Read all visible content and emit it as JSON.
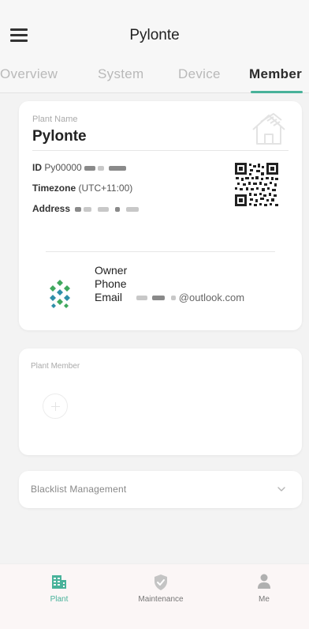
{
  "header": {
    "title": "Pylonte",
    "menu_icon": "hamburger-menu-icon"
  },
  "tabs": [
    {
      "label": "Overview",
      "active": false
    },
    {
      "label": "System",
      "active": false
    },
    {
      "label": "Device",
      "active": false
    },
    {
      "label": "Member",
      "active": true
    }
  ],
  "colors": {
    "accent": "#48b29a",
    "background": "#f3f3f3",
    "card": "#ffffff"
  },
  "plant": {
    "name_label": "Plant Name",
    "name": "Pylonte",
    "house_icon": "house-outline-icon",
    "qr_icon": "qr-code-icon",
    "id_label": "ID",
    "id_value": "Py00000",
    "timezone_label": "Timezone",
    "timezone_value": "(UTC+11:00)",
    "address_label": "Address"
  },
  "owner": {
    "logo_icon": "pylontech-logo-icon",
    "owner_label": "Owner",
    "phone_label": "Phone",
    "email_label": "Email",
    "email_value": "@outlook.com"
  },
  "member": {
    "label": "Plant Member",
    "add_icon": "add-circle-icon"
  },
  "blacklist": {
    "label": "Blacklist Management",
    "chevron_icon": "chevron-down-icon"
  },
  "bottom_nav": [
    {
      "label": "Plant",
      "icon": "plant-building-icon",
      "active": true
    },
    {
      "label": "Maintenance",
      "icon": "shield-check-icon",
      "active": false
    },
    {
      "label": "Me",
      "icon": "person-icon",
      "active": false
    }
  ]
}
